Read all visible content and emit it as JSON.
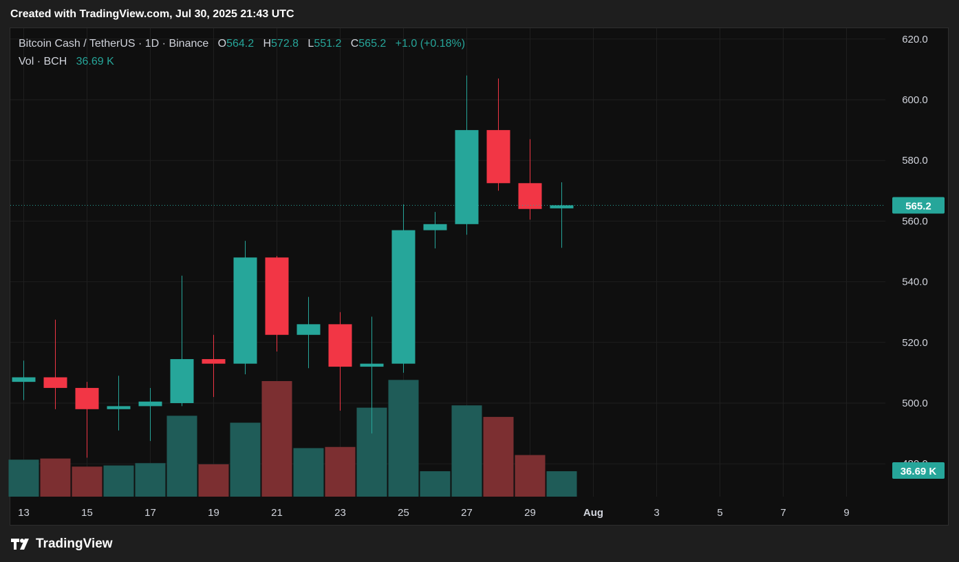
{
  "header": {
    "created_text": "Created with TradingView.com, Jul 30, 2025 21:43 UTC"
  },
  "legend": {
    "symbol": "Bitcoin Cash / TetherUS · 1D · Binance",
    "o_label": "O",
    "o_value": "564.2",
    "h_label": "H",
    "h_value": "572.8",
    "l_label": "L",
    "l_value": "551.2",
    "c_label": "C",
    "c_value": "565.2",
    "change": "+1.0 (+0.18%)",
    "vol_label": "Vol · BCH",
    "vol_value": "36.69 K"
  },
  "price_badge": "565.2",
  "volume_badge": "36.69 K",
  "footer": {
    "brand": "TradingView"
  },
  "colors": {
    "up": "#26a69a",
    "down": "#f23645",
    "up_vol": "#1f5c58",
    "down_vol": "#7c2f31",
    "grid": "#1f1f1f",
    "axis_text": "#d1d4dc"
  },
  "chart_data": {
    "type": "candlestick",
    "title": "Bitcoin Cash / TetherUS · 1D · Binance",
    "x_tick_labels": [
      "13",
      "15",
      "17",
      "19",
      "21",
      "23",
      "25",
      "27",
      "29",
      "Aug",
      "3",
      "5",
      "7",
      "9"
    ],
    "y_tick_labels": [
      "620.0",
      "600.0",
      "580.0",
      "560.0",
      "540.0",
      "520.0",
      "500.0",
      "480.0"
    ],
    "ylim": [
      480,
      620
    ],
    "last_price": 565.2,
    "last_volume_label": "36.69 K",
    "candles": [
      {
        "date": "Jul 13",
        "open": 507.0,
        "high": 514.0,
        "low": 501.0,
        "close": 508.5
      },
      {
        "date": "Jul 14",
        "open": 508.5,
        "high": 527.5,
        "low": 498.0,
        "close": 505.0
      },
      {
        "date": "Jul 15",
        "open": 505.0,
        "high": 507.0,
        "low": 482.0,
        "close": 498.0
      },
      {
        "date": "Jul 16",
        "open": 498.0,
        "high": 509.0,
        "low": 491.0,
        "close": 499.0
      },
      {
        "date": "Jul 17",
        "open": 499.0,
        "high": 505.0,
        "low": 487.5,
        "close": 500.5
      },
      {
        "date": "Jul 18",
        "open": 500.0,
        "high": 542.0,
        "low": 499.0,
        "close": 514.5
      },
      {
        "date": "Jul 19",
        "open": 514.5,
        "high": 522.5,
        "low": 502.0,
        "close": 513.0
      },
      {
        "date": "Jul 20",
        "open": 513.0,
        "high": 553.5,
        "low": 509.5,
        "close": 548.0
      },
      {
        "date": "Jul 21",
        "open": 548.0,
        "high": 548.5,
        "low": 517.0,
        "close": 522.5
      },
      {
        "date": "Jul 22",
        "open": 522.5,
        "high": 535.0,
        "low": 511.5,
        "close": 526.0
      },
      {
        "date": "Jul 23",
        "open": 526.0,
        "high": 530.0,
        "low": 497.5,
        "close": 512.0
      },
      {
        "date": "Jul 24",
        "open": 512.0,
        "high": 528.5,
        "low": 490.0,
        "close": 513.0
      },
      {
        "date": "Jul 25",
        "open": 513.0,
        "high": 565.5,
        "low": 510.0,
        "close": 557.0
      },
      {
        "date": "Jul 26",
        "open": 557.0,
        "high": 563.0,
        "low": 551.0,
        "close": 559.0
      },
      {
        "date": "Jul 27",
        "open": 559.0,
        "high": 608.0,
        "low": 555.5,
        "close": 590.0
      },
      {
        "date": "Jul 28",
        "open": 590.0,
        "high": 607.0,
        "low": 570.0,
        "close": 572.5
      },
      {
        "date": "Jul 29",
        "open": 572.5,
        "high": 587.0,
        "low": 560.5,
        "close": 564.0
      },
      {
        "date": "Jul 30",
        "open": 564.2,
        "high": 572.8,
        "low": 551.2,
        "close": 565.2
      }
    ],
    "volume_relative": [
      0.32,
      0.33,
      0.26,
      0.27,
      0.29,
      0.7,
      0.28,
      0.64,
      1.0,
      0.42,
      0.43,
      0.77,
      1.01,
      0.22,
      0.79,
      0.69,
      0.36,
      0.22
    ]
  }
}
